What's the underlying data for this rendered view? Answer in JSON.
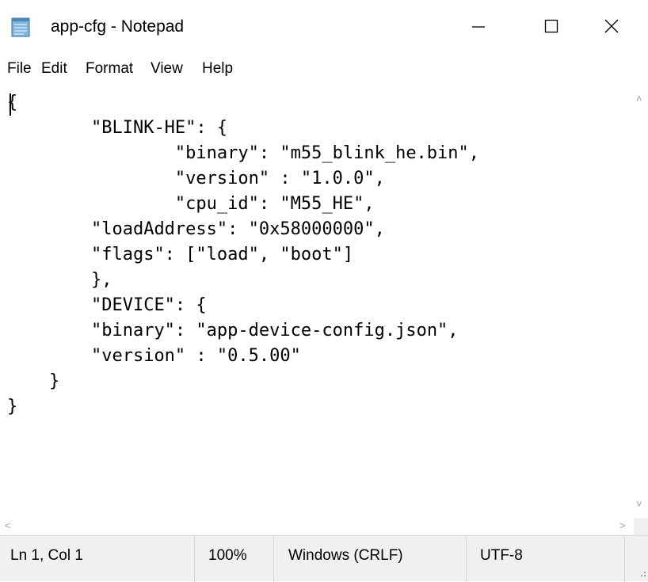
{
  "window": {
    "title": "app-cfg - Notepad",
    "app_icon": "notepad-icon",
    "controls": {
      "minimize_icon": "minimize-icon",
      "maximize_icon": "maximize-icon",
      "close_icon": "close-icon"
    }
  },
  "menu": {
    "file": "File",
    "edit": "Edit",
    "format": "Format",
    "view": "View",
    "help": "Help"
  },
  "editor": {
    "content": "{\n\t\"BLINK-HE\": {\n\t\t\"binary\": \"m55_blink_he.bin\",\n\t\t\"version\" : \"1.0.0\",\n\t\t\"cpu_id\": \"M55_HE\",\n\t\"loadAddress\": \"0x58000000\",\n\t\"flags\": [\"load\", \"boot\"]\n\t},\n\t\"DEVICE\": {\n\t\"binary\": \"app-device-config.json\",\n\t\"version\" : \"0.5.00\"\n    }\n}"
  },
  "status": {
    "position": "Ln 1, Col 1",
    "zoom": "100%",
    "line_ending": "Windows (CRLF)",
    "encoding": "UTF-8"
  }
}
